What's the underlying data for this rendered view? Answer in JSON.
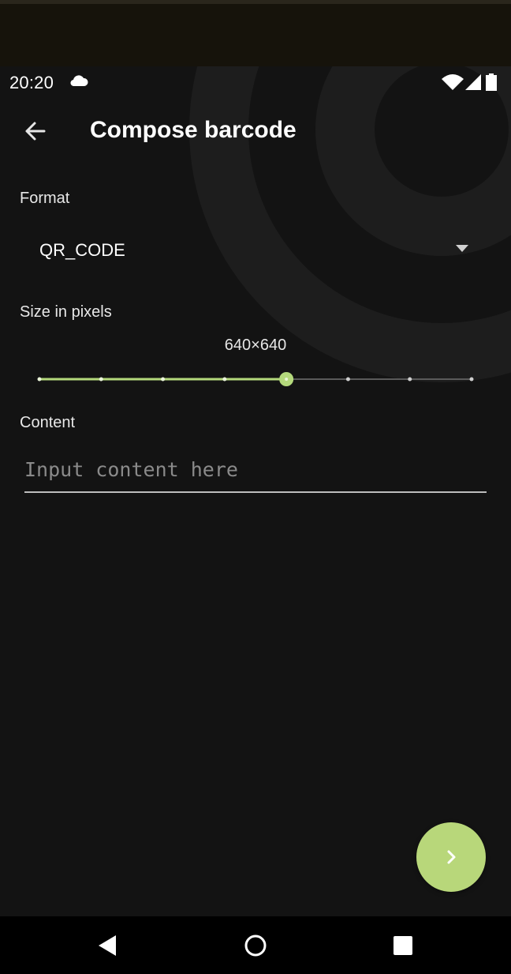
{
  "status_bar": {
    "time": "20:20",
    "cloud_icon": "cloud-icon",
    "wifi_icon": "wifi-icon",
    "signal_icon": "signal-icon",
    "battery_icon": "battery-icon"
  },
  "app_bar": {
    "back_icon": "arrow-back-icon",
    "title": "Compose barcode"
  },
  "format": {
    "label": "Format",
    "selected": "QR_CODE",
    "dropdown_icon": "dropdown-arrow-icon"
  },
  "size": {
    "label": "Size in pixels",
    "value_text": "640×640",
    "slider": {
      "steps": 8,
      "selected_index": 4
    }
  },
  "content": {
    "label": "Content",
    "value": "",
    "placeholder": "Input content here"
  },
  "fab": {
    "icon": "chevron-right-icon"
  },
  "nav_bar": {
    "back_icon": "nav-back-icon",
    "home_icon": "nav-home-icon",
    "recents_icon": "nav-recents-icon"
  },
  "colors": {
    "background": "#131313",
    "accent": "#b8d77a",
    "text_primary": "#ffffff",
    "text_secondary": "#e8e8e8",
    "placeholder": "#8a8a8a"
  }
}
